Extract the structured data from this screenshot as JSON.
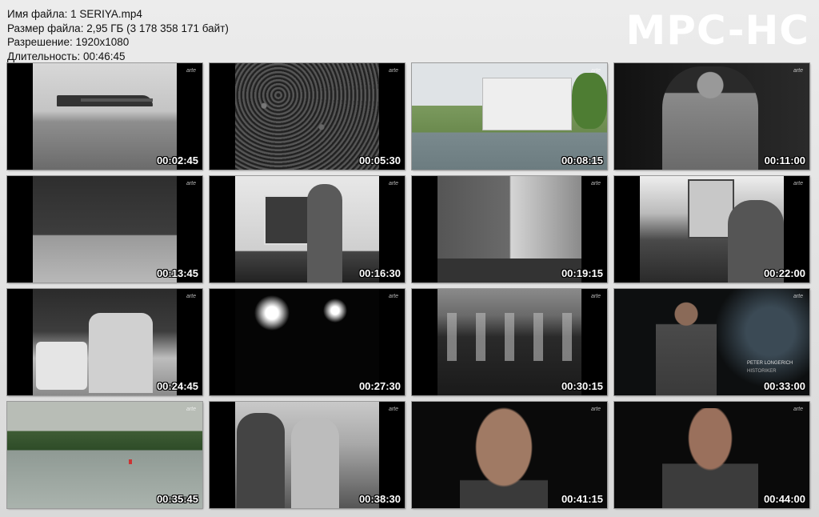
{
  "info": {
    "filename": "Имя файла: 1 SERIYA.mp4",
    "filesize": "Размер файла: 2,95 ГБ (3 178 358 171 байт)",
    "resolution": "Разрешение: 1920x1080",
    "duration": "Длительность: 00:46:45"
  },
  "logo": "MPC-HC",
  "watermark": "arte",
  "thumbnails": [
    {
      "time": "00:02:45",
      "scene": "airplane-on-field"
    },
    {
      "time": "00:05:30",
      "scene": "crowd"
    },
    {
      "time": "00:08:15",
      "scene": "rheinhotel-dreesen"
    },
    {
      "time": "00:11:00",
      "scene": "portrait-in-uniform"
    },
    {
      "time": "00:13:45",
      "scene": "forest-clearing"
    },
    {
      "time": "00:16:30",
      "scene": "man-with-flag"
    },
    {
      "time": "00:19:15",
      "scene": "half-timbered-street"
    },
    {
      "time": "00:22:00",
      "scene": "uniformed-men-with-flags"
    },
    {
      "time": "00:24:45",
      "scene": "children-at-table"
    },
    {
      "time": "00:27:30",
      "scene": "night-fires"
    },
    {
      "time": "00:30:15",
      "scene": "crowd-of-officials"
    },
    {
      "time": "00:33:00",
      "scene": "interview-seated-man",
      "caption1": "PETER LONGERICH",
      "caption2": "HISTORIKER"
    },
    {
      "time": "00:35:45",
      "scene": "river-landscape"
    },
    {
      "time": "00:38:30",
      "scene": "two-seated-men"
    },
    {
      "time": "00:41:15",
      "scene": "interview-closeup"
    },
    {
      "time": "00:44:00",
      "scene": "interview-medium"
    }
  ]
}
